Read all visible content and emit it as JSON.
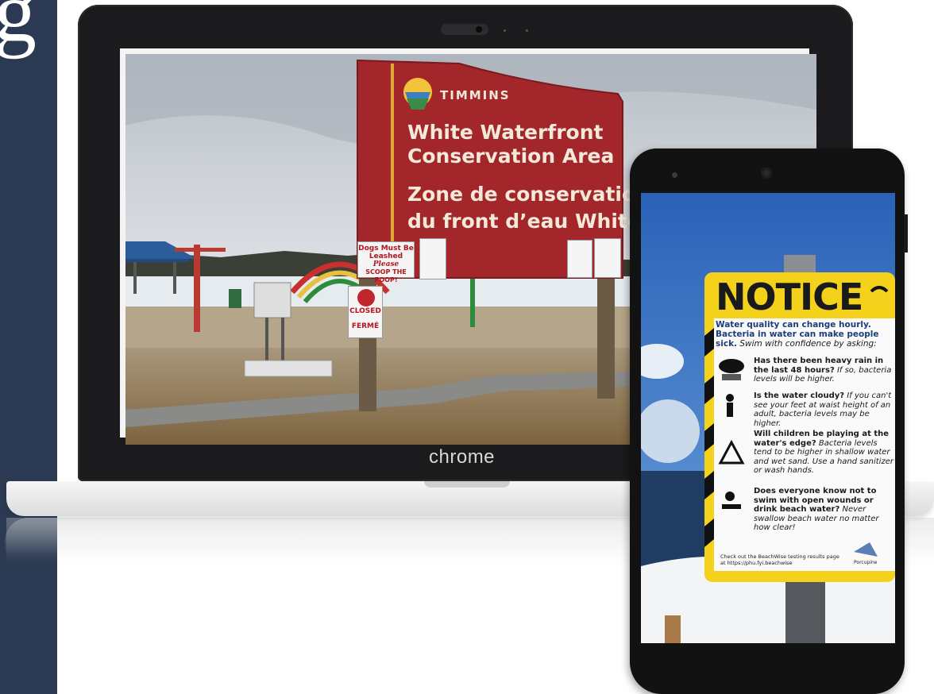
{
  "left_glyph": "g",
  "laptop": {
    "brand_label": "chrome"
  },
  "sign": {
    "city": "TIMMINS",
    "title_en_line1": "White Waterfront",
    "title_en_line2": "Conservation Area",
    "title_fr_line1": "Zone de conservation",
    "title_fr_line2": "du front d’eau White",
    "dogs_line1": "Dogs Must Be",
    "dogs_line2": "Leashed",
    "dogs_line3": "Please",
    "dogs_line4": "SCOOP THE POOP!",
    "closed_line1": "CLOSED",
    "closed_line2": "FERMÉ"
  },
  "notice": {
    "title": "NOTICE",
    "intro_bold": "Water quality can change hourly. Bacteria in water can make people sick.",
    "intro_italic": "Swim with confidence by asking:",
    "items": [
      {
        "bold": "Has there been heavy rain in the last 48 hours?",
        "italic": "If so, bacteria levels will be higher."
      },
      {
        "bold": "Is the water cloudy?",
        "italic": "If you can't see your feet at waist height of an adult, bacteria levels may be higher."
      },
      {
        "bold": "Will children be playing at the water's edge?",
        "italic": "Bacteria levels tend to be higher in shallow water and wet sand. Use a hand sanitizer or wash hands."
      },
      {
        "bold": "Does everyone know not to swim with open wounds or drink beach water?",
        "italic": "Never swallow beach water no matter how clear!"
      }
    ],
    "footer": "Check out the BeachWise testing results page at https://phu.fyi.beachwise",
    "footer_logo": "Porcupine"
  }
}
